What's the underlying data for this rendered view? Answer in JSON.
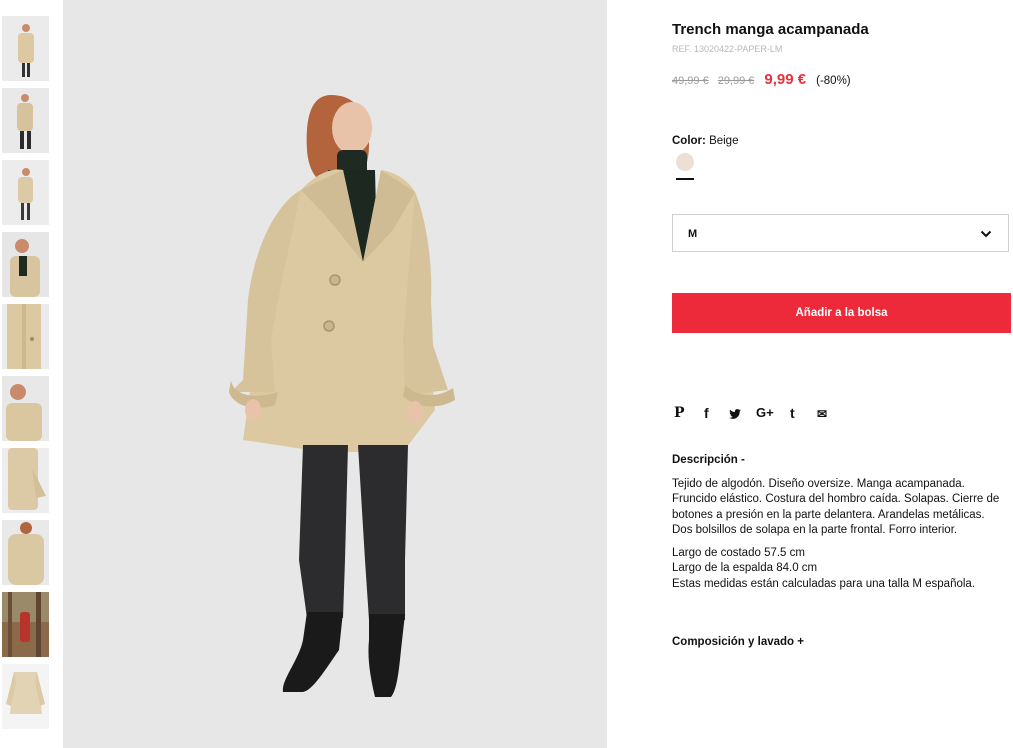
{
  "thumbnails": [
    {
      "label": "thumbnail-1"
    },
    {
      "label": "thumbnail-2"
    },
    {
      "label": "thumbnail-3"
    },
    {
      "label": "thumbnail-4"
    },
    {
      "label": "thumbnail-5"
    },
    {
      "label": "thumbnail-6"
    },
    {
      "label": "thumbnail-7"
    },
    {
      "label": "thumbnail-8"
    },
    {
      "label": "thumbnail-9"
    },
    {
      "label": "thumbnail-10"
    }
  ],
  "product": {
    "title": "Trench manga acampanada",
    "ref": "REF. 13020422-PAPER-LM",
    "price_old_1": "49,99 €",
    "price_old_2": "29,99 €",
    "price_sale": "9,99 €",
    "discount": "(-80%)"
  },
  "color": {
    "label": "Color:",
    "value": "Beige",
    "swatch_hex": "#ecdfd6"
  },
  "size": {
    "selected": "M"
  },
  "add_button": "Añadir a la bolsa",
  "social": {
    "pinterest": "P",
    "facebook": "f",
    "twitter": "t",
    "google": "G+",
    "tumblr": "t",
    "email": "✉"
  },
  "description": {
    "heading": "Descripción  -",
    "text": "Tejido de algodón. Diseño oversize. Manga acampanada. Fruncido elástico. Costura del hombro caída. Solapas. Cierre de botones a presión en la parte delantera. Arandelas metálicas. Dos bolsillos de solapa en la parte frontal. Forro interior.",
    "measure_1": "Largo de costado 57.5 cm",
    "measure_2": "Largo de la espalda 84.0 cm",
    "measure_3": "Estas medidas están calculadas para una talla M española."
  },
  "composition_heading": "Composición y lavado  +",
  "colors": {
    "accent": "#ed2a3a",
    "sale_price": "#e8313f",
    "coat": "#dcc9a2",
    "background": "#e7e7e8"
  }
}
